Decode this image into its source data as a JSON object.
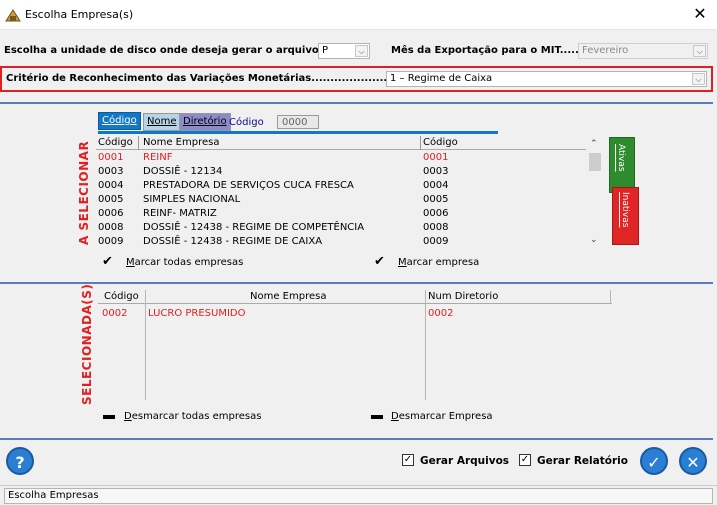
{
  "window": {
    "title": "Escolha Empresa(s)"
  },
  "options": {
    "disk_label": "Escolha a unidade de disco onde deseja gerar o arquivo:",
    "disk_value": "P",
    "month_label": "Mês da Exportação para o MIT.....:",
    "month_value": "Fevereiro",
    "criteria_label": "Critério de Reconhecimento das Variações Monetárias.......................:",
    "criteria_value": "1 – Regime de Caixa"
  },
  "to_select": {
    "section_label": "A SELECIONAR",
    "tabs": [
      {
        "label": "Código"
      },
      {
        "label": "Nome"
      },
      {
        "label": "Diretório"
      }
    ],
    "search_label": "Código",
    "search_value": "0000",
    "columns": [
      "Código",
      "Nome Empresa",
      "Código"
    ],
    "rows": [
      {
        "code": "0001",
        "name": "REINF",
        "dir": "0001",
        "selected": true
      },
      {
        "code": "0003",
        "name": "DOSSIÊ - 12134",
        "dir": "0003"
      },
      {
        "code": "0004",
        "name": "PRESTADORA DE SERVIÇOS CUCA FRESCA",
        "dir": "0004"
      },
      {
        "code": "0005",
        "name": "SIMPLES NACIONAL",
        "dir": "0005"
      },
      {
        "code": "0006",
        "name": "REINF-  MATRIZ",
        "dir": "0006"
      },
      {
        "code": "0008",
        "name": "DOSSIÊ - 12438 - REGIME DE COMPETÊNCIA",
        "dir": "0008"
      },
      {
        "code": "0009",
        "name": "DOSSIÊ - 12438 - REGIME DE CAIXA",
        "dir": "0009"
      }
    ],
    "mark_all": "Marcar todas empresas",
    "mark_one": "Marcar empresa",
    "ativas": "Ativas",
    "inativas": "Inativas"
  },
  "selected": {
    "section_label": "SELECIONADA(S)",
    "columns": [
      "Código",
      "Nome Empresa",
      "Num Diretorio"
    ],
    "rows": [
      {
        "code": "0002",
        "name": "LUCRO PRESUMIDO",
        "dir": "0002"
      }
    ],
    "unmark_all": "Desmarcar todas empresas",
    "unmark_one": "Desmarcar Empresa"
  },
  "footer": {
    "gen_files": "Gerar Arquivos",
    "gen_report": "Gerar Relatório",
    "help_glyph": "?",
    "ok_glyph": "✓",
    "cancel_glyph": "✕"
  },
  "status": {
    "text": "Escolha Empresas"
  },
  "colors": {
    "accent_red": "#e02020",
    "tab_blue": "#1177c6",
    "ativas_green": "#2e8b2e",
    "inativas_red": "#e02525",
    "btn_blue": "#2a7fd4"
  }
}
